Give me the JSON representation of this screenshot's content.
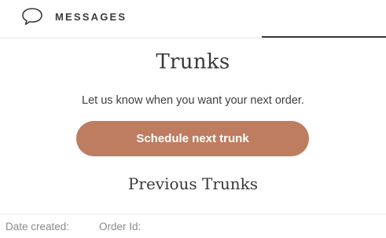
{
  "header": {
    "messages_label": "MESSAGES",
    "messages_icon": "chat-bubble-icon"
  },
  "main": {
    "title": "Trunks",
    "subtitle": "Let us know when you want your next order.",
    "schedule_button_label": "Schedule next trunk",
    "previous_title": "Previous Trunks"
  },
  "table": {
    "columns": [
      "Date created:",
      "Order Id:"
    ]
  },
  "colors": {
    "accent": "#be7d61",
    "text": "#3a3a3a",
    "muted": "#8a8a8a"
  }
}
